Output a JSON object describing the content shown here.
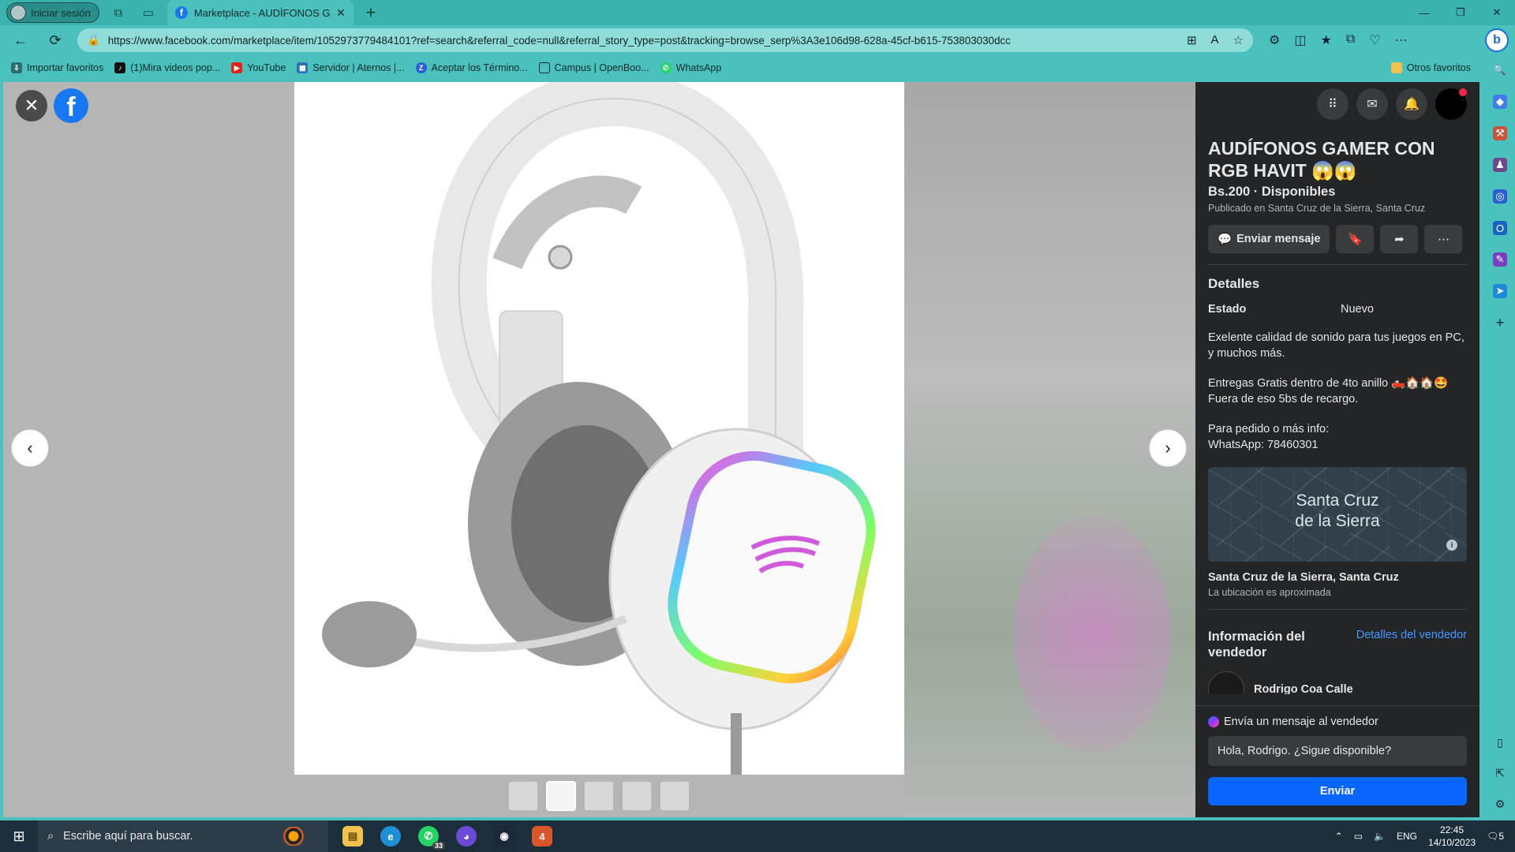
{
  "browser": {
    "profile_label": "Iniciar sesión",
    "tab_title": "Marketplace - AUDÍFONOS GAM",
    "url": "https://www.facebook.com/marketplace/item/1052973779484101?ref=search&referral_code=null&referral_story_type=post&tracking=browse_serp%3A3e106d98-628a-45cf-b615-753803030dcc",
    "favorites": [
      {
        "label": "Importar favoritos",
        "icon": "import-icon"
      },
      {
        "label": "(1)Mira videos pop...",
        "icon": "tiktok-icon"
      },
      {
        "label": "YouTube",
        "icon": "youtube-icon"
      },
      {
        "label": "Servidor | Aternos |...",
        "icon": "aternos-icon"
      },
      {
        "label": "Aceptar los Término...",
        "icon": "z-icon"
      },
      {
        "label": "Campus | OpenBoo...",
        "icon": "page-icon"
      },
      {
        "label": "WhatsApp",
        "icon": "whatsapp-icon"
      }
    ],
    "other_favorites": "Otros favoritos"
  },
  "listing": {
    "title": "AUDÍFONOS GAMER CON RGB HAVIT 😱😱",
    "price": "Bs.200 · Disponibles",
    "published": "Publicado en Santa Cruz de la Sierra, Santa Cruz",
    "send_message_label": "Enviar mensaje",
    "details_heading": "Detalles",
    "condition_key": "Estado",
    "condition_value": "Nuevo",
    "desc_1": "Exelente calidad de sonido para tus juegos en PC, y muchos más.",
    "desc_2": "Entregas Gratis dentro de 4to anillo 🛻🏠🏠🤩 Fuera de eso 5bs de recargo.",
    "desc_3a": "Para pedido o más info:",
    "desc_3b": "WhatsApp: 78460301",
    "map_city_line1": "Santa Cruz",
    "map_city_line2": "de la Sierra",
    "location": "Santa Cruz de la Sierra, Santa Cruz",
    "location_note": "La ubicación es aproximada",
    "seller_heading": "Información del vendedor",
    "seller_link": "Detalles del vendedor",
    "seller_name": "Rodrigo Coa Calle",
    "ask_label": "Envía un mensaje al vendedor",
    "message_value": "Hola, Rodrigo. ¿Sigue disponible?",
    "send_label": "Enviar"
  },
  "taskbar": {
    "search_placeholder": "Escribe aquí para buscar.",
    "whatsapp_badge": "33",
    "lang": "ENG",
    "time": "22:45",
    "date": "14/10/2023",
    "notif_count": "5"
  },
  "colors": {
    "browser_accent": "#4ac1bd",
    "fb_blue": "#1877f2",
    "send_button": "#0866ff",
    "panel_bg": "#242526"
  }
}
